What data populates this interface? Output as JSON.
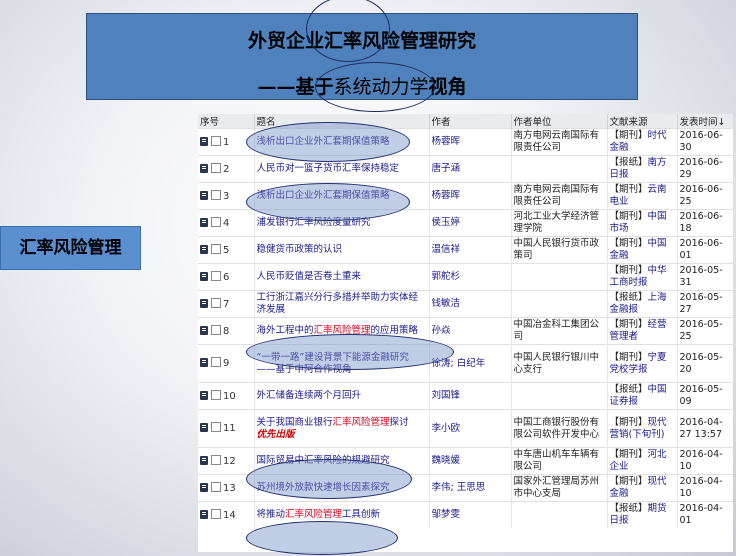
{
  "slide": {
    "title_line1": "外贸企业汇率风险管理研究",
    "title_line2_prefix": "——基于",
    "title_line2_mid": "系统动力学",
    "title_line2_suffix": "视角",
    "side_label": "汇率风险管理"
  },
  "table": {
    "headers": [
      "序号",
      "题名",
      "作者",
      "作者单位",
      "文献来源",
      "发表时间↓"
    ],
    "rows": [
      {
        "num": "1",
        "title": "浅析出口企业外汇套期保值策略",
        "author": "杨蓉晖",
        "unit": "南方电网云南国际有限责任公司",
        "src_tag": "【期刊】",
        "src_name": "时代金融",
        "date": "2016-06-30"
      },
      {
        "num": "2",
        "title": "人民币对一篮子货币汇率保持稳定",
        "author": "唐子涵",
        "unit": "",
        "src_tag": "【报纸】",
        "src_name": "南方日报",
        "date": "2016-06-29"
      },
      {
        "num": "3",
        "title": "浅析出口企业外汇套期保值策略",
        "author": "杨蓉晖",
        "unit": "南方电网云南国际有限责任公司",
        "src_tag": "【期刊】",
        "src_name": "云南电业",
        "date": "2016-06-25"
      },
      {
        "num": "4",
        "title": "浦发银行汇率风险度量研究",
        "author": "侯玉婷",
        "unit": "河北工业大学经济管理学院",
        "src_tag": "【期刊】",
        "src_name": "中国市场",
        "date": "2016-06-18"
      },
      {
        "num": "5",
        "title": "稳健货币政策的认识",
        "author": "温信祥",
        "unit": "中国人民银行货币政策司",
        "src_tag": "【期刊】",
        "src_name": "中国金融",
        "date": "2016-06-01"
      },
      {
        "num": "6",
        "title": "人民币贬值是否卷土重来",
        "author": "郭舵杉",
        "unit": "",
        "src_tag": "【期刊】",
        "src_name": "中华工商时报",
        "date": "2016-05-31"
      },
      {
        "num": "7",
        "title": "工行浙江嘉兴分行多措并举助力实体经济发展",
        "author": "钱敏洁",
        "unit": "",
        "src_tag": "【报纸】",
        "src_name": "上海金融报",
        "date": "2016-05-27"
      },
      {
        "num": "8",
        "title_pre": "海外工程中的",
        "title_hl": "汇率风险管理",
        "title_post": "的应用策略",
        "author": "孙焱",
        "unit": "中国冶金科工集团公司",
        "src_tag": "【期刊】",
        "src_name": "经营管理者",
        "date": "2016-05-25"
      },
      {
        "num": "9",
        "title": "“一带一路”建设背景下能源金融研究——基于中阿合作视角",
        "author": "徐涛; 白纪年",
        "unit": "中国人民银行银川中心支行",
        "src_tag": "【期刊】",
        "src_name": "宁夏党校学报",
        "date": "2016-05-20"
      },
      {
        "num": "10",
        "title": "外汇储备连续两个月回升",
        "author": "刘国锋",
        "unit": "",
        "src_tag": "【报纸】",
        "src_name": "中国证券报",
        "date": "2016-05-09"
      },
      {
        "num": "11",
        "title_pre": "关于我国商业银行",
        "title_hl": "汇率风险管理",
        "title_post": "探讨",
        "title_badge": "优先出版",
        "author": "李小欧",
        "unit": "中国工商银行股份有限公司软件开发中心",
        "src_tag": "【期刊】",
        "src_name": "现代营销(下旬刊)",
        "date": "2016-04-27 13:57"
      },
      {
        "num": "12",
        "title": "国际贸易中汇率风险的规避研究",
        "author": "魏晓媛",
        "unit": "中车唐山机车车辆有限公司",
        "src_tag": "【期刊】",
        "src_name": "河北企业",
        "date": "2016-04-10"
      },
      {
        "num": "13",
        "title": "苏州境外放款快速增长因素探究",
        "author": "李伟; 王思思",
        "unit": "国家外汇管理局苏州市中心支局",
        "src_tag": "【期刊】",
        "src_name": "现代金融",
        "date": "2016-04-10"
      },
      {
        "num": "14",
        "title_pre": "将推动",
        "title_hl": "汇率风险管理",
        "title_post": "工具创新",
        "author": "邹梦雯",
        "unit": "",
        "src_tag": "【报纸】",
        "src_name": "期货日报",
        "date": "2016-04-01"
      }
    ]
  },
  "icons": {
    "row_doc": "document-icon",
    "row_check": "checkbox"
  }
}
